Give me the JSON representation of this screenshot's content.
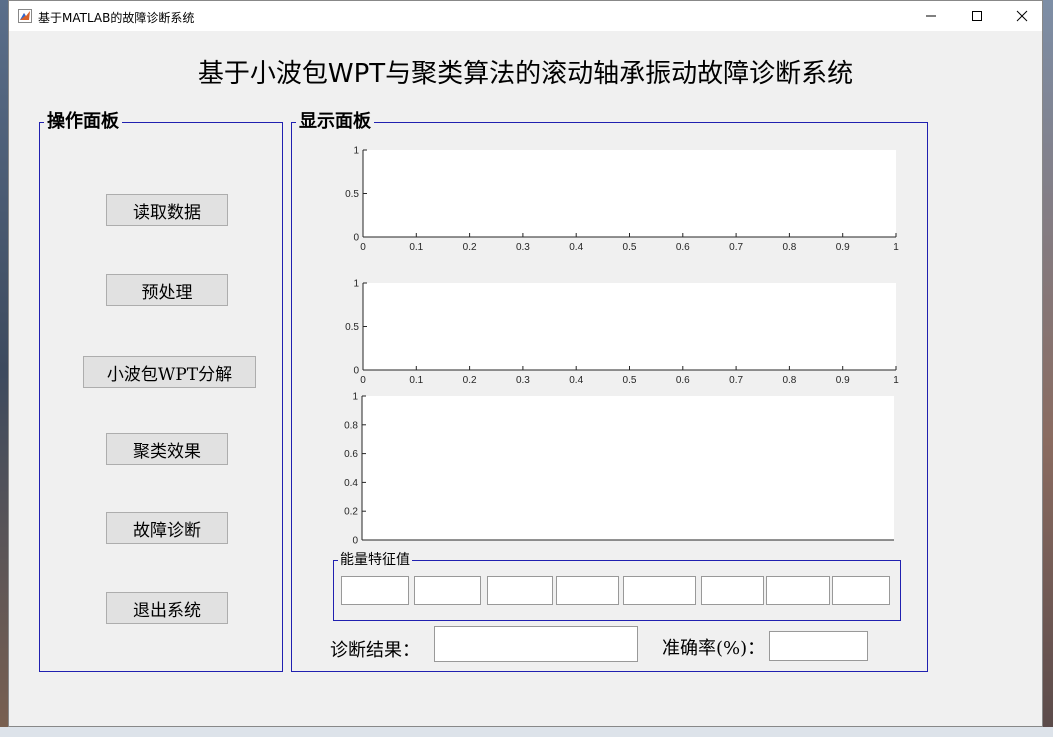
{
  "window": {
    "title": "基于MATLAB的故障诊断系统",
    "controls": [
      "minimize",
      "maximize",
      "close"
    ]
  },
  "main_title": "基于小波包WPT与聚类算法的滚动轴承振动故障诊断系统",
  "operation_panel": {
    "title": "操作面板",
    "buttons": [
      "读取数据",
      "预处理",
      "小波包WPT分解",
      "聚类效果",
      "故障诊断",
      "退出系统"
    ]
  },
  "display_panel": {
    "title": "显示面板",
    "chart_data": [
      {
        "type": "line",
        "series": [],
        "xlim": [
          0,
          1
        ],
        "ylim": [
          0,
          1
        ],
        "xticks": [
          "0",
          "0.1",
          "0.2",
          "0.3",
          "0.4",
          "0.5",
          "0.6",
          "0.7",
          "0.8",
          "0.9",
          "1"
        ],
        "yticks": [
          "0",
          "0.5",
          "1"
        ]
      },
      {
        "type": "line",
        "series": [],
        "xlim": [
          0,
          1
        ],
        "ylim": [
          0,
          1
        ],
        "xticks": [
          "0",
          "0.1",
          "0.2",
          "0.3",
          "0.4",
          "0.5",
          "0.6",
          "0.7",
          "0.8",
          "0.9",
          "1"
        ],
        "yticks": [
          "0",
          "0.5",
          "1"
        ]
      },
      {
        "type": "line",
        "series": [],
        "xlim": [
          0,
          1
        ],
        "ylim": [
          0,
          1
        ],
        "xticks": [],
        "yticks": [
          "0",
          "0.2",
          "0.4",
          "0.6",
          "0.8",
          "1"
        ]
      }
    ],
    "feature_group": {
      "title": "能量特征值",
      "values": [
        "",
        "",
        "",
        "",
        "",
        "",
        "",
        ""
      ]
    },
    "diagnosis_label": "诊断结果：",
    "diagnosis_value": "",
    "accuracy_label": "准确率(%)：",
    "accuracy_value": ""
  }
}
